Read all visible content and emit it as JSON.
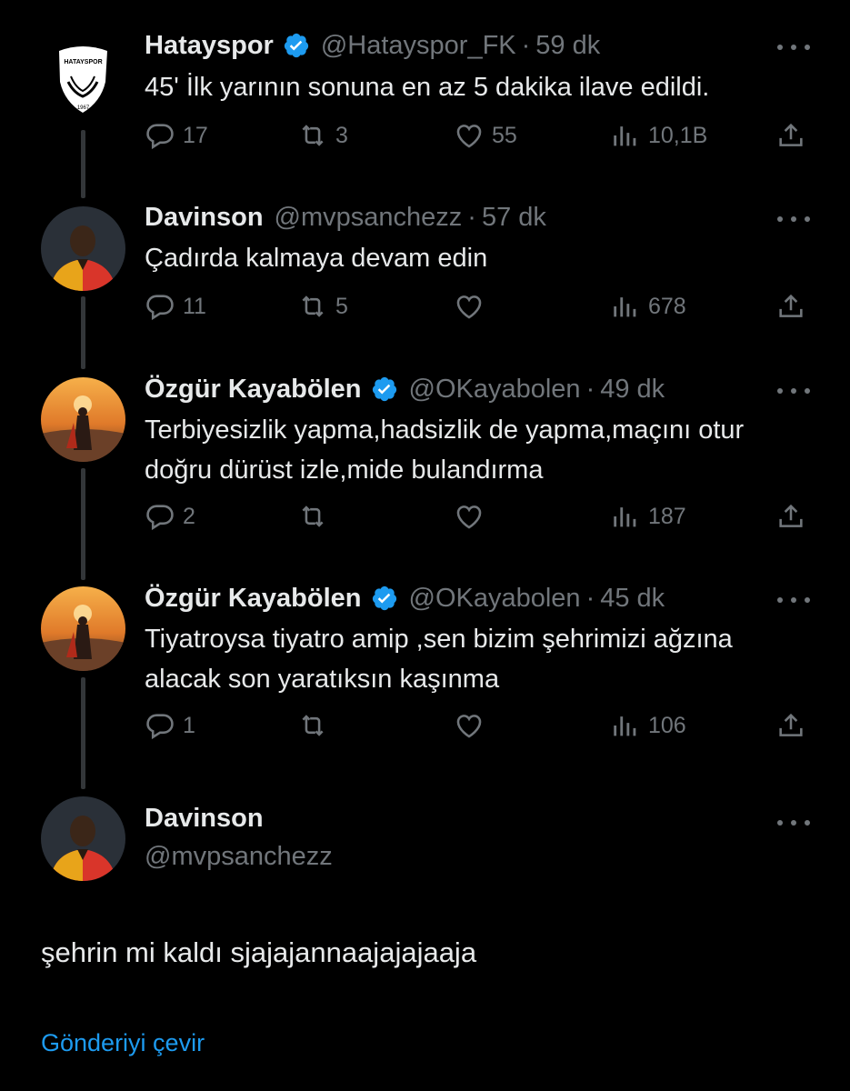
{
  "colors": {
    "background": "#000000",
    "text": "#e7e9ea",
    "muted": "#71767b",
    "link": "#1d9bf0",
    "verified": "#1d9bf0"
  },
  "tweets": [
    {
      "name": "Hatayspor",
      "verified": true,
      "handle": "@Hatayspor_FK",
      "time": "59 dk",
      "text": "45' İlk yarının sonuna en az 5 dakika ilave edildi.",
      "avatar": "hatayspor-logo",
      "avatar_text": [
        "HATAYSPOR",
        "1967"
      ],
      "replies": "17",
      "retweets": "3",
      "likes": "55",
      "views": "10,1B"
    },
    {
      "name": "Davinson",
      "verified": false,
      "handle": "@mvpsanchezz",
      "time": "57 dk",
      "text": "Çadırda kalmaya devam edin",
      "avatar": "player-photo",
      "replies": "11",
      "retweets": "5",
      "likes": "",
      "views": "678"
    },
    {
      "name": "Özgür Kayabölen",
      "verified": true,
      "handle": "@OKayabolen",
      "time": "49 dk",
      "text": "Terbiyesizlik yapma,hadsizlik de yapma,maçını otur doğru dürüst izle,mide bulandırma",
      "avatar": "sunset-photo",
      "replies": "2",
      "retweets": "",
      "likes": "",
      "views": "187"
    },
    {
      "name": "Özgür Kayabölen",
      "verified": true,
      "handle": "@OKayabolen",
      "time": "45 dk",
      "text": "Tiyatroysa tiyatro amip ,sen bizim şehrimizi ağzına alacak son yaratıksın kaşınma",
      "avatar": "sunset-photo",
      "replies": "1",
      "retweets": "",
      "likes": "",
      "views": "106"
    }
  ],
  "main_tweet": {
    "name": "Davinson",
    "handle": "@mvpsanchezz",
    "text": "şehrin mi kaldı sjajajannaajajajaaja",
    "translate_label": "Gönderiyi çevir"
  }
}
